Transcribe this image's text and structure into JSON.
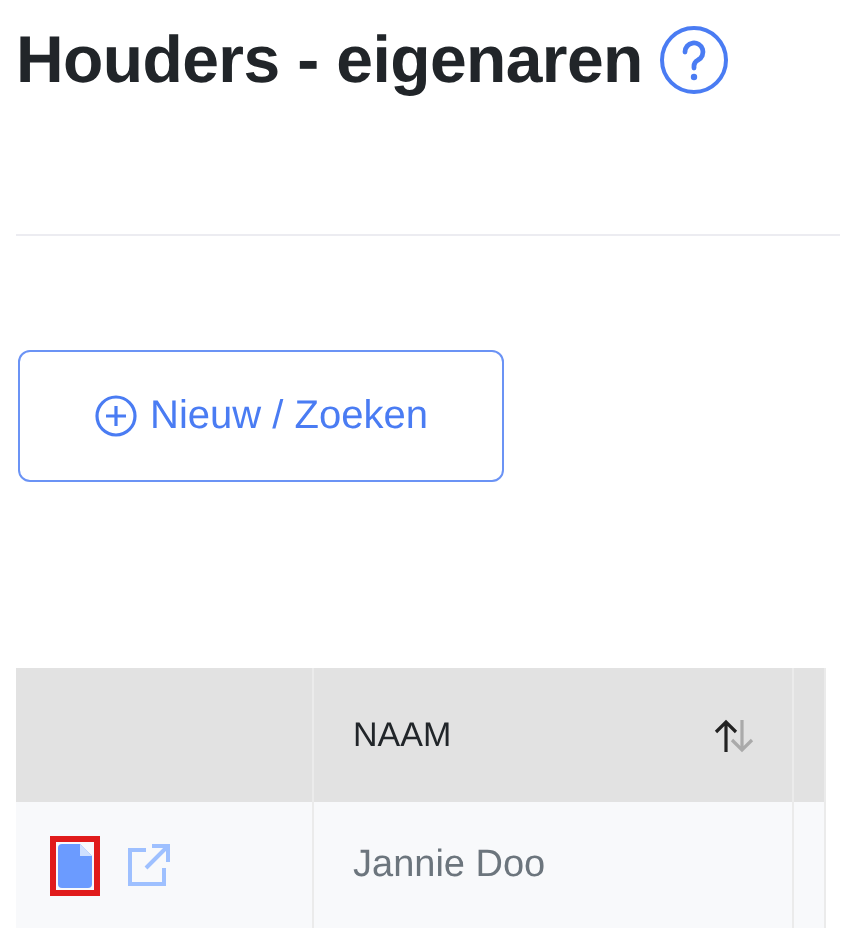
{
  "title": "Houders - eigenaren",
  "new_button": {
    "label": "Nieuw / Zoeken"
  },
  "table": {
    "columns": [
      {
        "label": "NAAM",
        "sort_ascending": true
      }
    ],
    "rows": [
      {
        "name": "Jannie Doo",
        "document_highlighted": true
      }
    ]
  }
}
